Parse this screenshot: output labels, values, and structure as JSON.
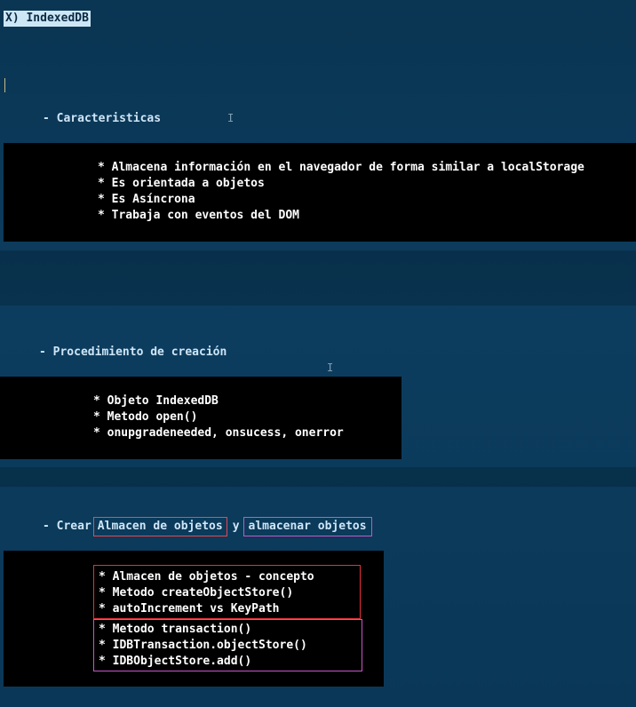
{
  "title": "X) IndexedDB",
  "section1": {
    "heading": "- Caracteristicas",
    "items": [
      "* Almacena información en el navegador de forma similar a localStorage",
      "* Es orientada a objetos",
      "* Es Asíncrona",
      "* Trabaja con eventos del DOM"
    ]
  },
  "section2": {
    "heading": "- Procedimiento de creación",
    "items": [
      "* Objeto IndexedDB",
      "* Metodo open()",
      "* onupgradeneeded, onsucess, onerror"
    ]
  },
  "section3": {
    "heading_prefix": "- Crear",
    "highlight1": "Almacen de objetos",
    "connector": "y",
    "highlight2": "almacenar objetos",
    "group1": [
      "* Almacen de objetos - concepto",
      "* Metodo createObjectStore()",
      "* autoIncrement vs KeyPath"
    ],
    "group2": [
      "* Metodo transaction()",
      "* IDBTransaction.objectStore()",
      "* IDBObjectStore.add()"
    ]
  },
  "colors": {
    "background": "#0b3a5a",
    "box": "#000000",
    "heading": "#cfe6f7",
    "highlight_red": "#e8494f",
    "highlight_pink": "#c856c8"
  }
}
